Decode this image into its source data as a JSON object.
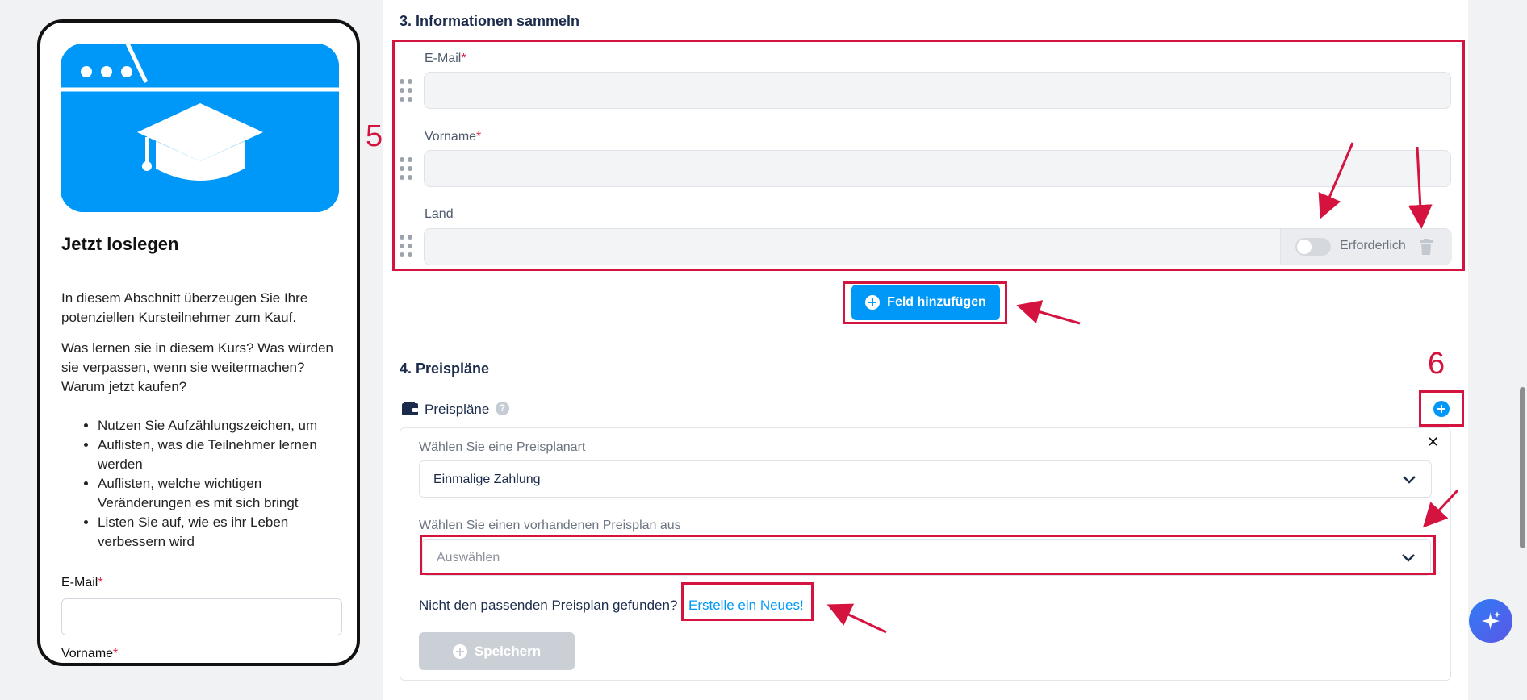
{
  "preview": {
    "title": "Jetzt loslegen",
    "paragraph1": "In diesem Abschnitt überzeugen Sie Ihre potenziellen Kursteilnehmer zum Kauf.",
    "paragraph2": "Was lernen sie in diesem Kurs? Was würden sie verpassen, wenn sie weitermachen? Warum jetzt kaufen?",
    "bullets": [
      "Nutzen Sie Aufzählungszeichen, um",
      "Auflisten, was die Teilnehmer lernen werden",
      "Auflisten, welche wichtigen Veränderungen es mit sich bringt",
      "Listen Sie auf, wie es ihr Leben verbessern wird"
    ],
    "email_label": "E-Mail",
    "firstname_label": "Vorname",
    "required_mark": "*"
  },
  "section3": {
    "title": "3. Informationen sammeln",
    "fields": [
      {
        "label": "E-Mail",
        "required": "*"
      },
      {
        "label": "Vorname",
        "required": "*"
      },
      {
        "label": "Land",
        "required": ""
      }
    ],
    "required_toggle_label": "Erforderlich",
    "required_toggle_on": false,
    "add_field_label": "Feld hinzufügen"
  },
  "section4": {
    "title": "4. Preispläne",
    "header_label": "Preispläne",
    "type_label": "Wählen Sie eine Preisplanart",
    "type_value": "Einmalige Zahlung",
    "existing_label": "Wählen Sie einen vorhandenen Preisplan aus",
    "existing_placeholder": "Auswählen",
    "not_found_text": "Nicht den passenden Preisplan gefunden?",
    "create_link": "Erstelle ein Neues!",
    "save_label": "Speichern",
    "close_symbol": "✕"
  },
  "annotations": {
    "step5": "5",
    "step6": "6",
    "color": "#d4133f"
  },
  "colors": {
    "accent": "#0098f8",
    "heading": "#1b2b4b",
    "required": "#e0244a",
    "link": "#0098f8"
  }
}
